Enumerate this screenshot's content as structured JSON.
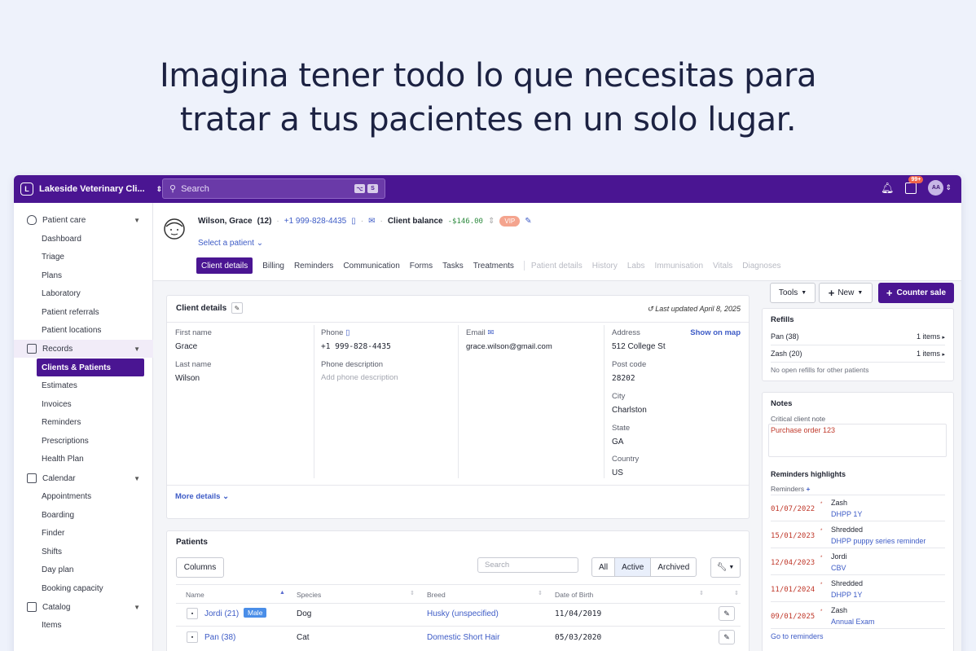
{
  "headline": {
    "line1": "Imagina tener todo lo que necesitas para",
    "line2": "tratar a tus pacientes en un solo lugar."
  },
  "topbar": {
    "clinic_initial": "L",
    "clinic_name": "Lakeside Veterinary Cli...",
    "search_placeholder": "Search",
    "notification_badge": "99+",
    "avatar_initials": "AA"
  },
  "sidebar": {
    "patient_care": "Patient care",
    "patient_care_items": [
      "Dashboard",
      "Triage",
      "Plans",
      "Laboratory",
      "Patient referrals",
      "Patient locations"
    ],
    "records": "Records",
    "records_items": [
      "Clients & Patients",
      "Estimates",
      "Invoices",
      "Reminders",
      "Prescriptions",
      "Health Plan"
    ],
    "calendar": "Calendar",
    "calendar_items": [
      "Appointments",
      "Boarding",
      "Finder",
      "Shifts",
      "Day plan",
      "Booking capacity"
    ],
    "catalog": "Catalog",
    "catalog_items": [
      "Items"
    ]
  },
  "header": {
    "client_name": "Wilson, Grace",
    "client_count": "(12)",
    "phone": "+1 999-828-4435",
    "balance_label": "Client balance",
    "balance": "-$146.00",
    "vip": "VIP",
    "select_patient": "Select a patient"
  },
  "tabs": {
    "active": [
      "Client details",
      "Billing",
      "Reminders",
      "Communication",
      "Forms",
      "Tasks",
      "Treatments"
    ],
    "disabled": [
      "Patient details",
      "History",
      "Labs",
      "Immunisation",
      "Vitals",
      "Diagnoses"
    ]
  },
  "client_details": {
    "title": "Client details",
    "last_updated": "Last updated April 8, 2025",
    "first_name_label": "First name",
    "first_name": "Grace",
    "last_name_label": "Last name",
    "last_name": "Wilson",
    "phone_label": "Phone",
    "phone": "+1 999-828-4435",
    "phone_desc_label": "Phone description",
    "phone_desc_placeholder": "Add phone description",
    "email_label": "Email",
    "email": "grace.wilson@gmail.com",
    "address_label": "Address",
    "show_on_map": "Show on map",
    "address": "512 College St",
    "post_code_label": "Post code",
    "post_code": "28202",
    "city_label": "City",
    "city": "Charlston",
    "state_label": "State",
    "state": "GA",
    "country_label": "Country",
    "country": "US",
    "more_details": "More details"
  },
  "patients": {
    "title": "Patients",
    "columns_btn": "Columns",
    "search_placeholder": "Search",
    "filters": [
      "All",
      "Active",
      "Archived"
    ],
    "headers": [
      "Name",
      "Species",
      "Breed",
      "Date of Birth"
    ],
    "rows": [
      {
        "name": "Jordi (21)",
        "tag": "Male",
        "species": "Dog",
        "breed": "Husky (unspecified)",
        "dob": "11/04/2019"
      },
      {
        "name": "Pan (38)",
        "tag": "",
        "species": "Cat",
        "breed": "Domestic Short Hair",
        "dob": "05/03/2020"
      }
    ]
  },
  "right": {
    "tools": "Tools",
    "new": "New",
    "counter_sale": "Counter sale",
    "refills_title": "Refills",
    "refills": [
      {
        "name": "Pan (38)",
        "count": "1 items"
      },
      {
        "name": "Zash (20)",
        "count": "1 items"
      }
    ],
    "no_refills": "No open refills for other patients",
    "notes_title": "Notes",
    "critical_label": "Critical client note",
    "critical_note": "Purchase order 123",
    "reminders_title": "Reminders highlights",
    "reminders_label": "Reminders",
    "reminders": [
      {
        "date": "01/07/2022",
        "patient": "Zash",
        "name": "DHPP 1Y"
      },
      {
        "date": "15/01/2023",
        "patient": "Shredded",
        "name": "DHPP puppy series reminder"
      },
      {
        "date": "12/04/2023",
        "patient": "Jordi",
        "name": "CBV"
      },
      {
        "date": "11/01/2024",
        "patient": "Shredded",
        "name": "DHPP 1Y"
      },
      {
        "date": "09/01/2025",
        "patient": "Zash",
        "name": "Annual Exam"
      }
    ],
    "go_to_reminders": "Go to reminders"
  },
  "colors": {
    "brand": "#4a1592",
    "link": "#3d5bc6",
    "overdue": "#c0392b",
    "balance": "#2d8a3e",
    "vip": "#f4a48e"
  }
}
